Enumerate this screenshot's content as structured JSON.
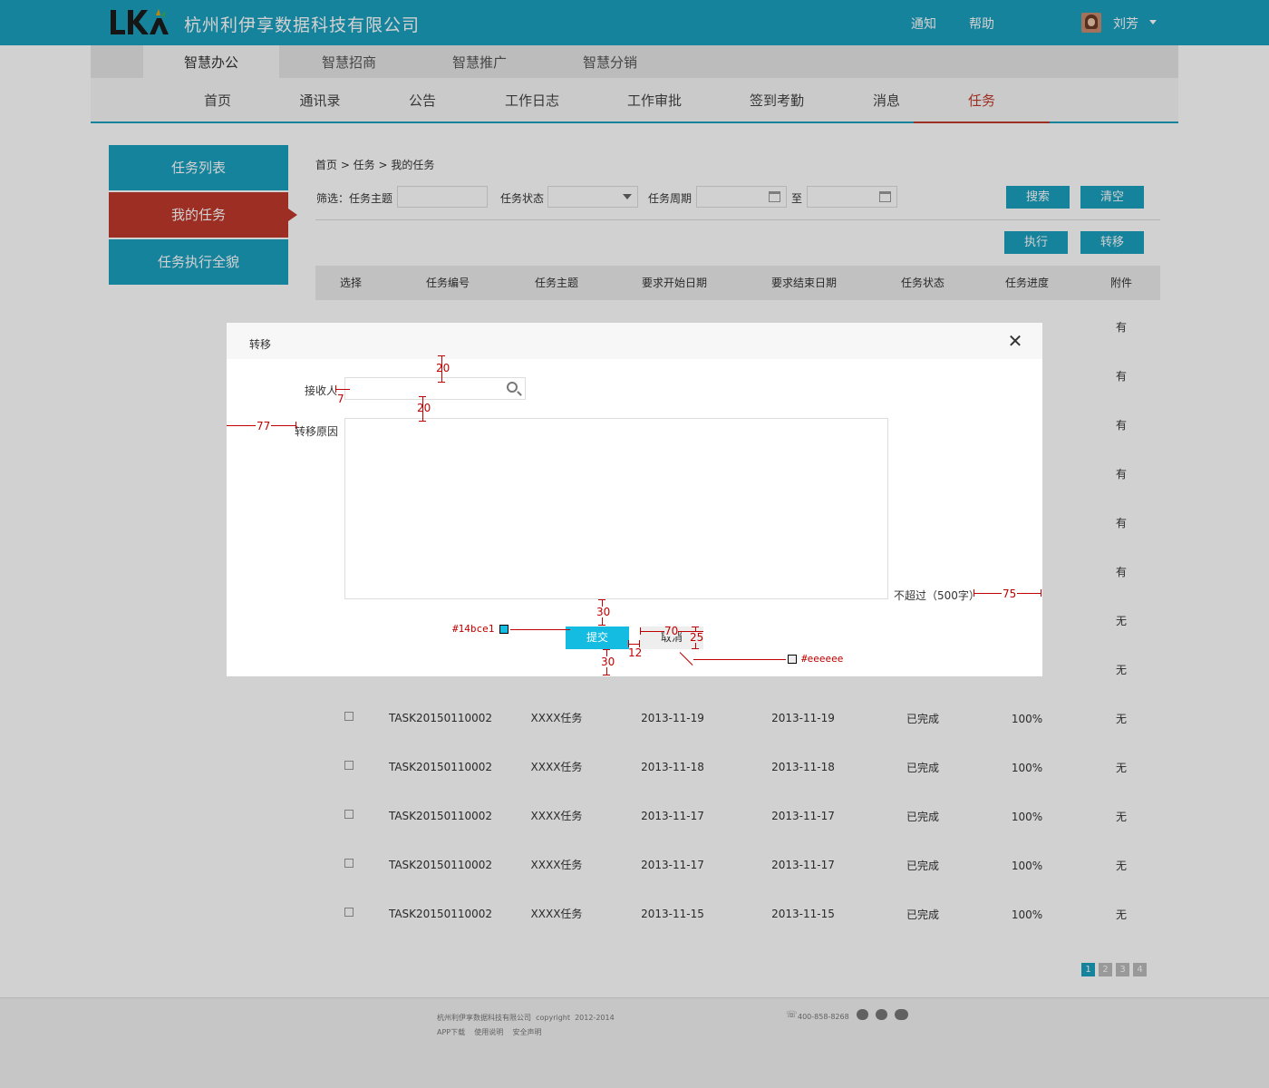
{
  "header": {
    "logo_text": "LKA",
    "company": "杭州利伊享数据科技有限公司",
    "notify": "通知",
    "help": "帮助",
    "user_name": "刘芳"
  },
  "module_tabs": [
    "智慧办公",
    "智慧招商",
    "智慧推广",
    "智慧分销"
  ],
  "nav": [
    "首页",
    "通讯录",
    "公告",
    "工作日志",
    "工作审批",
    "签到考勤",
    "消息",
    "任务"
  ],
  "sidebar": [
    "任务列表",
    "我的任务",
    "任务执行全貌"
  ],
  "breadcrumb": "首页 > 任务 > 我的任务",
  "filters": {
    "topic_label": "筛选：任务主题",
    "status_label": "任务状态",
    "period_label": "任务周期",
    "to": "至",
    "search": "搜索",
    "clear": "清空",
    "execute": "执行",
    "transfer": "转移"
  },
  "table": {
    "headers": [
      "选择",
      "任务编号",
      "任务主题",
      "要求开始日期",
      "要求结束日期",
      "任务状态",
      "任务进度",
      "附件"
    ],
    "attachments_behind_modal": [
      "有",
      "有",
      "有",
      "有",
      "有",
      "有",
      "无",
      "无"
    ],
    "rows": [
      {
        "id": "TASK20150110002",
        "topic": "XXXX任务",
        "start": "2013-11-19",
        "end": "2013-11-19",
        "status": "已完成",
        "progress": "100%",
        "attach": "无"
      },
      {
        "id": "TASK20150110002",
        "topic": "XXXX任务",
        "start": "2013-11-18",
        "end": "2013-11-18",
        "status": "已完成",
        "progress": "100%",
        "attach": "无"
      },
      {
        "id": "TASK20150110002",
        "topic": "XXXX任务",
        "start": "2013-11-17",
        "end": "2013-11-17",
        "status": "已完成",
        "progress": "100%",
        "attach": "无"
      },
      {
        "id": "TASK20150110002",
        "topic": "XXXX任务",
        "start": "2013-11-17",
        "end": "2013-11-17",
        "status": "已完成",
        "progress": "100%",
        "attach": "无"
      },
      {
        "id": "TASK20150110002",
        "topic": "XXXX任务",
        "start": "2013-11-15",
        "end": "2013-11-15",
        "status": "已完成",
        "progress": "100%",
        "attach": "无"
      }
    ]
  },
  "pagination": [
    "1",
    "2",
    "3",
    "4"
  ],
  "footer": {
    "copyright": "杭州利伊享数据科技有限公司  copyright  2012-2014",
    "links": "APP下载    使用说明    安全声明",
    "phone": "400-858-8268"
  },
  "modal": {
    "title": "转移",
    "close": "✕",
    "receiver_label": "接收人",
    "reason_label": "转移原因",
    "limit": "不超过（500字）",
    "submit": "提交",
    "cancel": "取消"
  },
  "annotations": {
    "top_20": "20",
    "gap_7": "7",
    "mid_20": "20",
    "left_77": "77",
    "right_75": "75",
    "btn_gap_30": "30",
    "btn_bottom_30": "30",
    "btn_w_70": "70",
    "btn_h_25": "25",
    "btn_space_12": "12",
    "submit_color": "#14bce1",
    "cancel_color": "#eeeeee"
  },
  "colors": {
    "brand": "#1ba0c0",
    "active_red": "#c0392b",
    "submit": "#14bce1",
    "cancel": "#eeeeee"
  }
}
